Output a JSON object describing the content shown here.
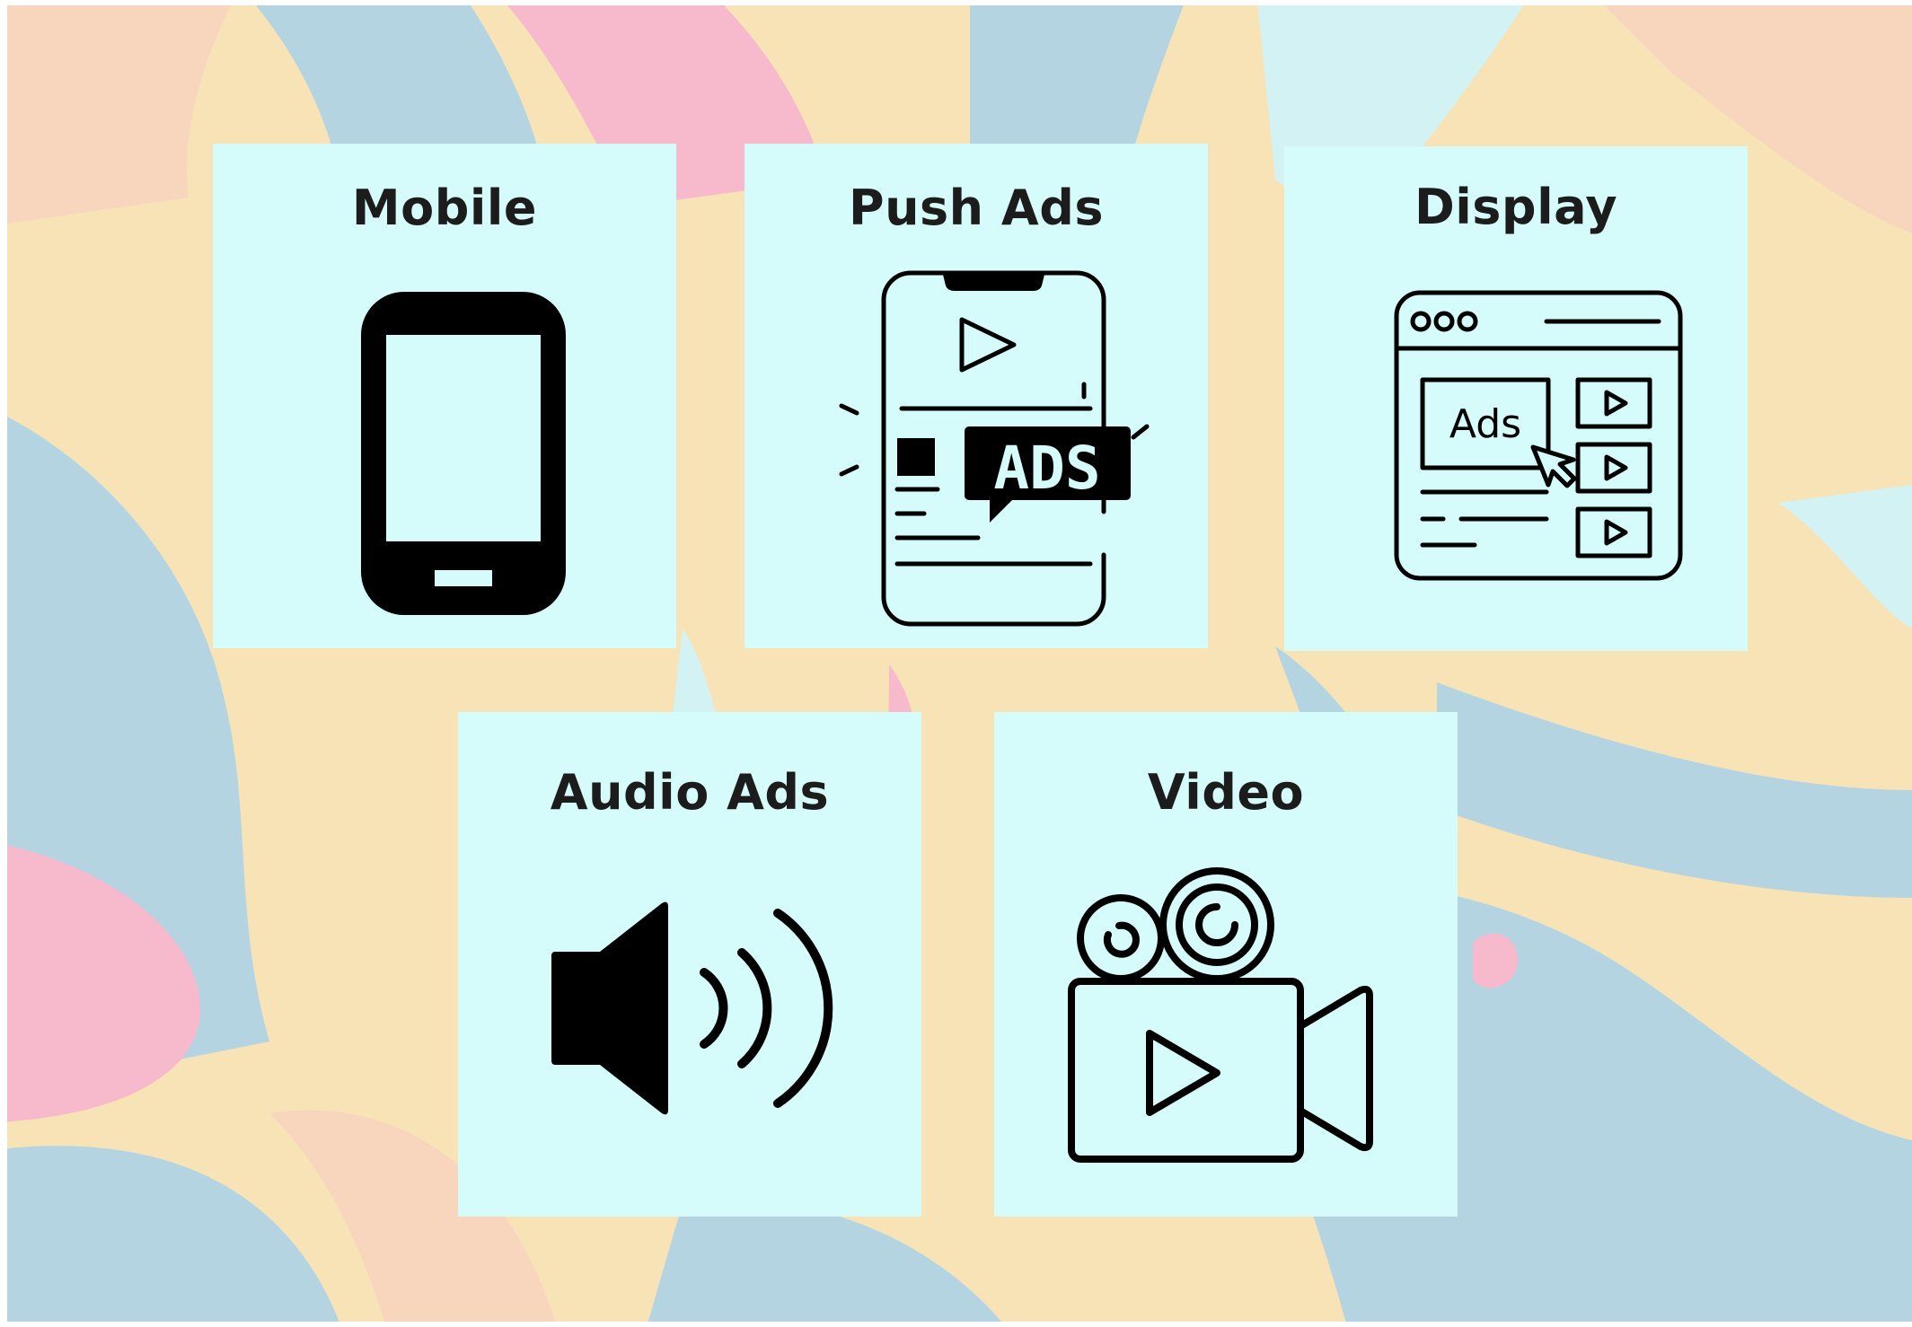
{
  "cards": {
    "mobile": {
      "title": "Mobile",
      "icon": "smartphone-icon"
    },
    "push": {
      "title": "Push Ads",
      "icon": "push-ads-phone-icon",
      "badge": "ADS"
    },
    "display": {
      "title": "Display",
      "icon": "display-browser-icon",
      "label": "Ads"
    },
    "audio": {
      "title": "Audio Ads",
      "icon": "speaker-volume-icon"
    },
    "video": {
      "title": "Video",
      "icon": "video-camera-icon"
    }
  },
  "colors": {
    "card_background": "#d5fbfb",
    "icon_ink": "#000000",
    "background_cream": "#f7e3b6",
    "background_blue": "#b5d4e2",
    "background_pink": "#f7b9cc",
    "background_peach": "#f8d6be"
  }
}
